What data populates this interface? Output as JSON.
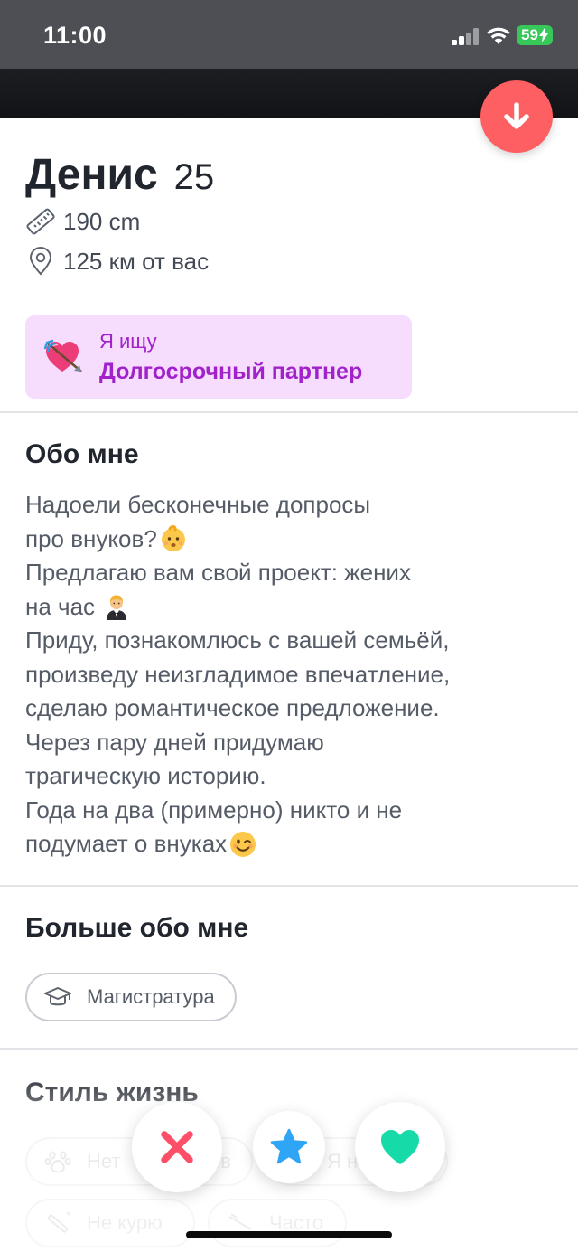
{
  "status_bar": {
    "time": "11:00",
    "battery": "59"
  },
  "profile": {
    "name": "Денис",
    "age": "25",
    "height": "190 cm",
    "distance": "125 км от вас",
    "looking_for": {
      "caption": "Я ищу",
      "value": "Долгосрочный партнер",
      "emoji": "heart-with-arrow"
    }
  },
  "about": {
    "title": "Обо мне",
    "lines": [
      "Надоели бесконечные допросы",
      "про внуков?",
      "Предлагаю вам свой проект: жених",
      "на час ",
      "Приду, познакомлюсь с вашей семьёй,",
      "произведу неизгладимое впечатление,",
      "сделаю романтическое предложение.",
      "Через пару дней придумаю",
      "трагическую историю.",
      "Года на два (примерно) никто и не",
      "подумает о внуках"
    ],
    "inline_emojis": [
      "baby",
      "man-in-tuxedo",
      "winking-face"
    ]
  },
  "more_about": {
    "title": "Больше обо мне",
    "education": "Магистратура"
  },
  "lifestyle": {
    "title": "Стиль жизнь",
    "chips": [
      "Нет",
      "ев",
      "Я н",
      "Не курю",
      "Часто"
    ]
  },
  "actions": {
    "nope": "close-icon",
    "super_like": "star-icon",
    "like": "heart-icon"
  },
  "colors": {
    "accent_red": "#fd5f62",
    "looking_bg": "#f6dcfd",
    "looking_text": "#a121cb",
    "star_blue": "#2ea5f5",
    "heart_green": "#16dba9"
  }
}
